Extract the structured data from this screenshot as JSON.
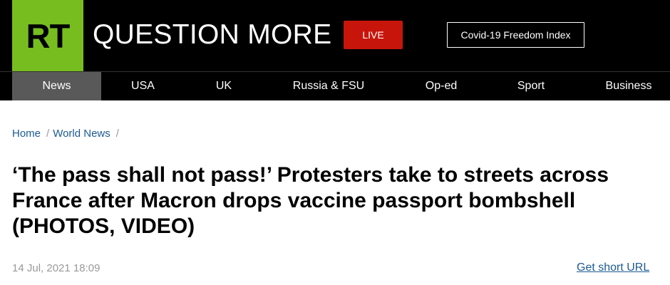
{
  "header": {
    "logo_text": "RT",
    "tagline": "QUESTION MORE",
    "live_label": "LIVE",
    "index_label": "Covid-19 Freedom Index"
  },
  "nav": {
    "items": [
      "News",
      "USA",
      "UK",
      "Russia & FSU",
      "Op-ed",
      "Sport",
      "Business"
    ],
    "active": "News"
  },
  "breadcrumb": {
    "home": "Home",
    "section": "World News"
  },
  "article": {
    "title": "‘The pass shall not pass!’ Protesters take to streets across France after Macron drops vaccine passport bombshell (PHOTOS, VIDEO)",
    "date": "14 Jul, 2021 18:09",
    "short_url_label": "Get short URL"
  },
  "colors": {
    "logo_green": "#77bd1f",
    "live_red": "#c8150c",
    "link_blue": "#1b5a92",
    "active_tab": "#595959"
  }
}
